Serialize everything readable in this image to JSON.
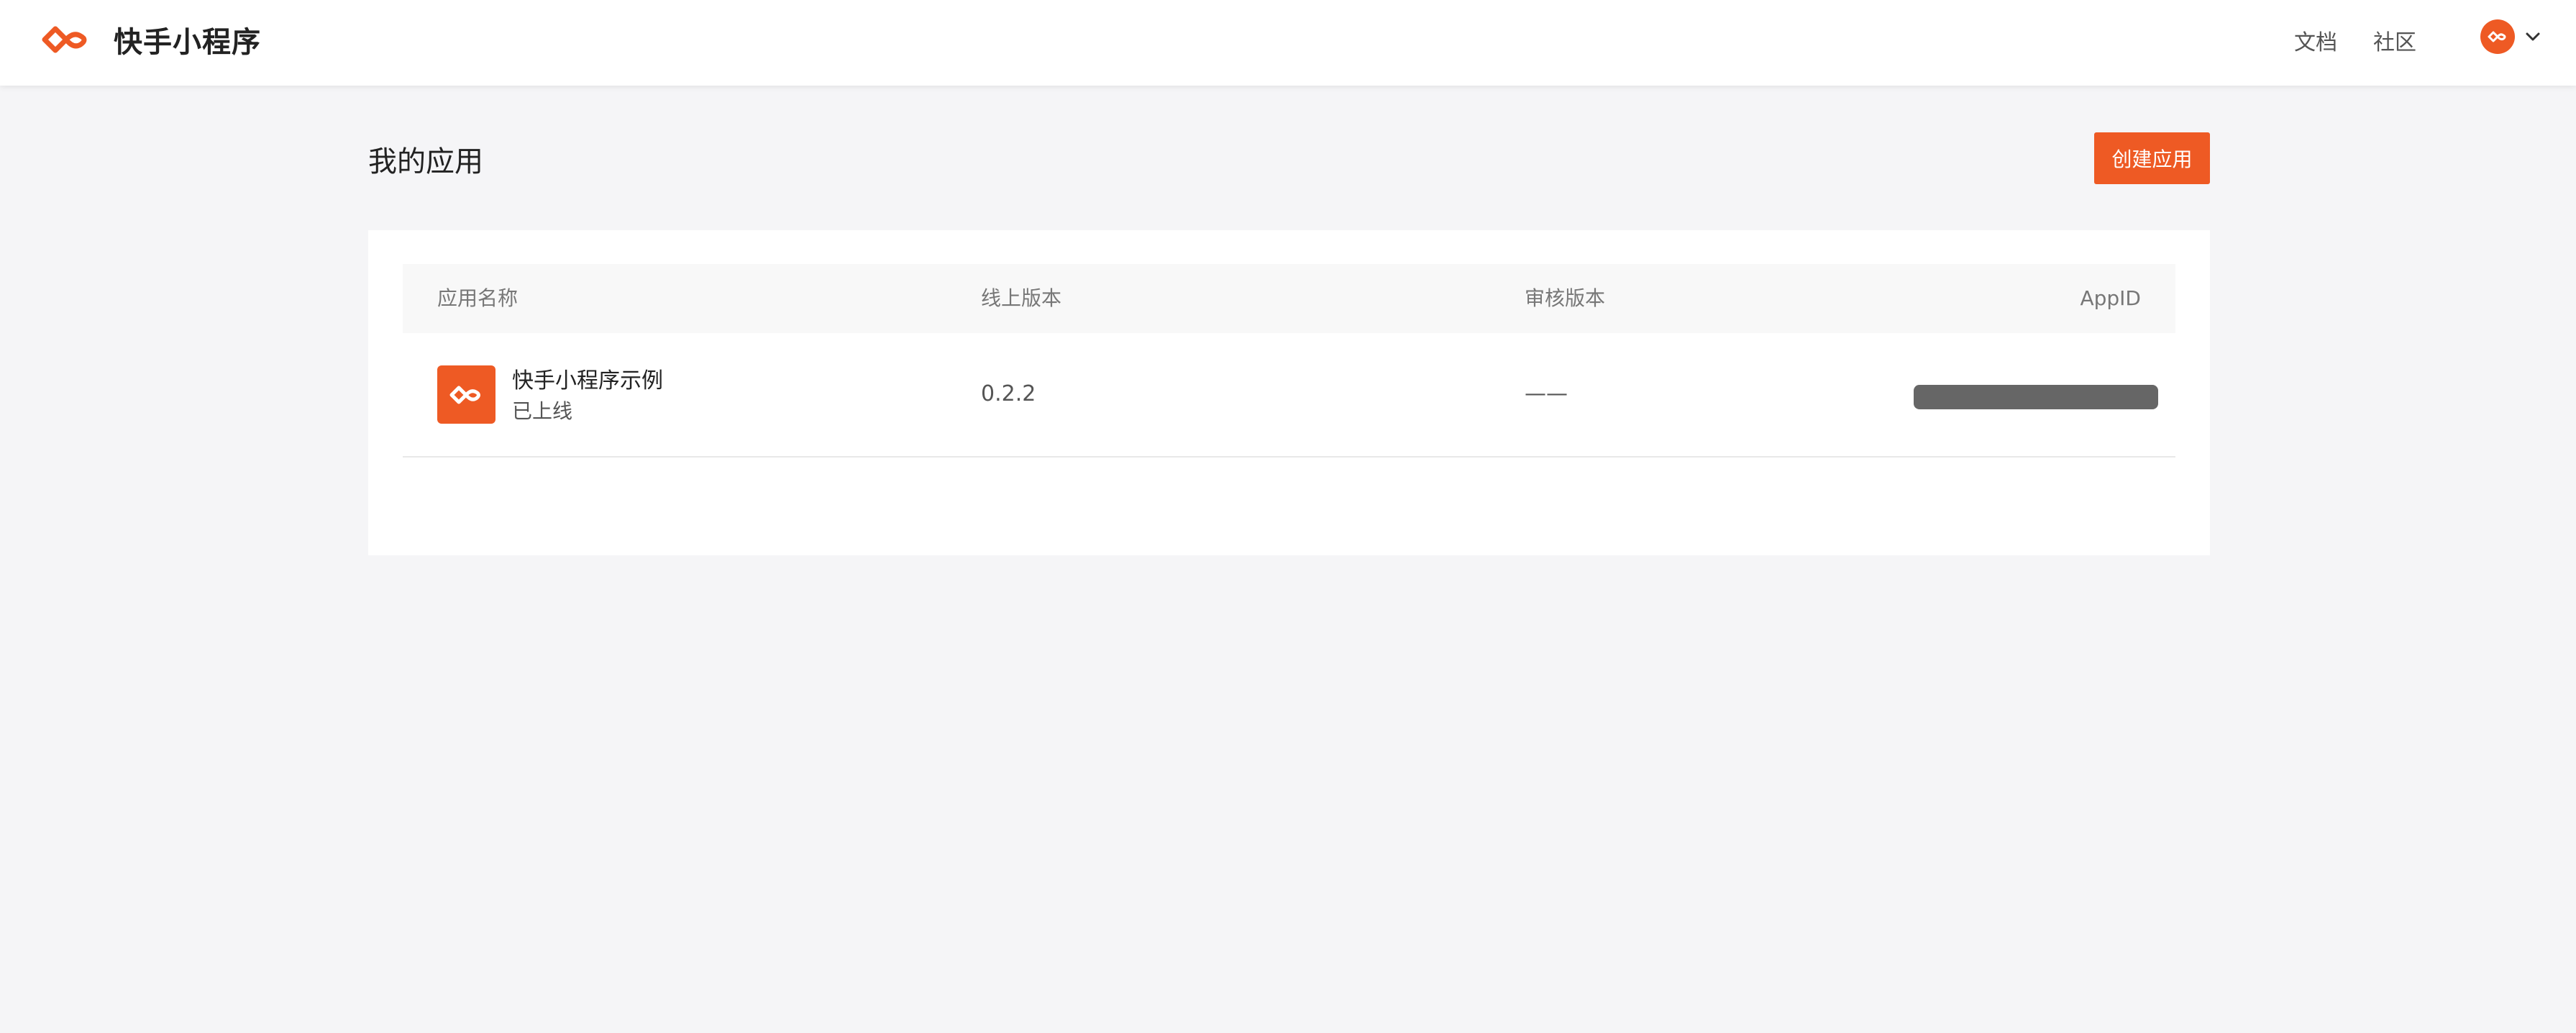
{
  "header": {
    "brand_title": "快手小程序",
    "nav": [
      {
        "label": "文档"
      },
      {
        "label": "社区"
      }
    ],
    "user_menu": {
      "avatar_icon": "kuaishou-logo-icon",
      "dropdown_icon": "chevron-down-icon"
    }
  },
  "page": {
    "title": "我的应用",
    "create_button_label": "创建应用"
  },
  "table": {
    "columns": [
      "应用名称",
      "线上版本",
      "审核版本",
      "AppID"
    ],
    "rows": [
      {
        "icon": "kuaishou-logo-icon",
        "name": "快手小程序示例",
        "status": "已上线",
        "online_version": "0.2.2",
        "review_version": "——",
        "appid": ""
      }
    ]
  },
  "colors": {
    "accent": "#ee5a24",
    "page_background": "#f5f5f7",
    "card_background": "#ffffff",
    "table_header_background": "#f8f8f8",
    "redaction": "#666666"
  }
}
